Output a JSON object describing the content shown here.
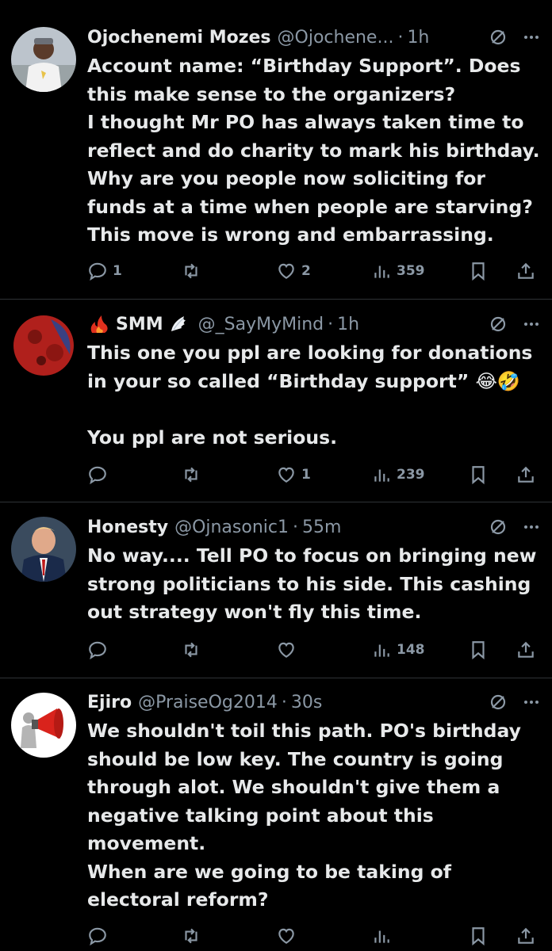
{
  "tweets": [
    {
      "name": "Ojochenemi Mozes",
      "name_badge": "",
      "handle": "@Ojochene...",
      "time": "1h",
      "lines": [
        "Account name: “Birthday Support”. Does",
        "this make sense to the organizers?",
        "I thought Mr PO has always taken time to",
        "reflect and do charity to mark his birthday.",
        "Why are you people now soliciting for",
        "funds at a time when people are starving?",
        "This move is wrong and embarrassing."
      ],
      "replies": "1",
      "retweets": "",
      "likes": "2",
      "views": "359"
    },
    {
      "name": "SMM",
      "name_badge": "wing",
      "handle": "@_SayMyMind",
      "time": "1h",
      "lines": [
        "This one you ppl are looking for donations",
        "in your so called “Birthday support” 😂🤣",
        "",
        "You ppl are not serious."
      ],
      "replies": "",
      "retweets": "",
      "likes": "1",
      "views": "239"
    },
    {
      "name": "Honesty",
      "name_badge": "",
      "handle": "@Ojnasonic1",
      "time": "55m",
      "lines": [
        "No way.... Tell PO to focus on bringing new",
        "strong politicians to his side. This cashing",
        "out strategy won't fly this time."
      ],
      "replies": "",
      "retweets": "",
      "likes": "",
      "views": "148"
    },
    {
      "name": "Ejiro",
      "name_badge": "",
      "handle": "@PraiseOg2014",
      "time": "30s",
      "lines": [
        "We shouldn't toil this path. PO's birthday",
        "should be low key. The country is going",
        "through alot. We shouldn't give them a",
        "negative talking point about this",
        "movement.",
        "When are we going to be taking of",
        "electoral reform?"
      ],
      "replies": "",
      "retweets": "",
      "likes": "",
      "views": ""
    }
  ],
  "separator": "·",
  "icons": {
    "reply": "reply-icon",
    "retweet": "retweet-icon",
    "like": "heart-icon",
    "views": "views-icon",
    "bookmark": "bookmark-icon",
    "share": "share-icon",
    "grok": "grok-icon",
    "more": "more-icon"
  },
  "colors": {
    "background": "#000000",
    "text": "#e7e9ea",
    "muted": "#8b98a5",
    "divider": "#2f3336"
  }
}
